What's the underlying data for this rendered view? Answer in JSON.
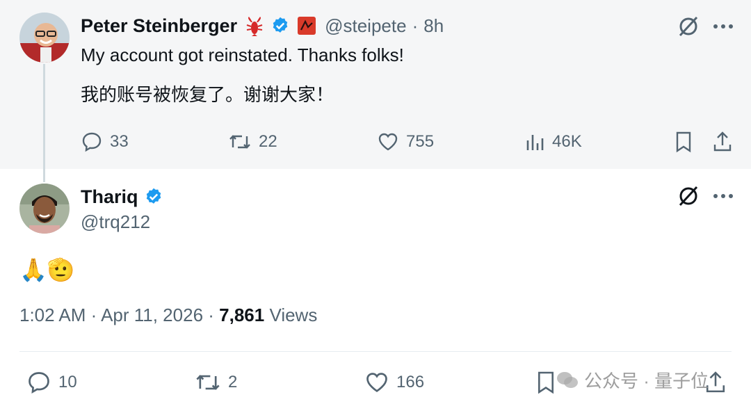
{
  "quoted_tweet": {
    "author_name": "Peter Steinberger",
    "handle": "@steipete",
    "separator": "·",
    "time_ago": "8h",
    "text_en": "My account got reinstated. Thanks folks!",
    "text_zh": "我的账号被恢复了。谢谢大家！",
    "replies": "33",
    "reposts": "22",
    "likes": "755",
    "views": "46K"
  },
  "main_tweet": {
    "author_name": "Thariq",
    "handle": "@trq212",
    "body": "🙏🫡",
    "timestamp": "1:02 AM · Apr 11, 2026 · ",
    "views_count": "7,861",
    "views_label": " Views",
    "replies": "10",
    "reposts": "2",
    "likes": "166"
  },
  "watermark": {
    "text": "公众号 · 量子位"
  },
  "colors": {
    "verified": "#1d9bf0",
    "text_secondary": "#536471",
    "quoted_bg": "#f5f6f7"
  }
}
